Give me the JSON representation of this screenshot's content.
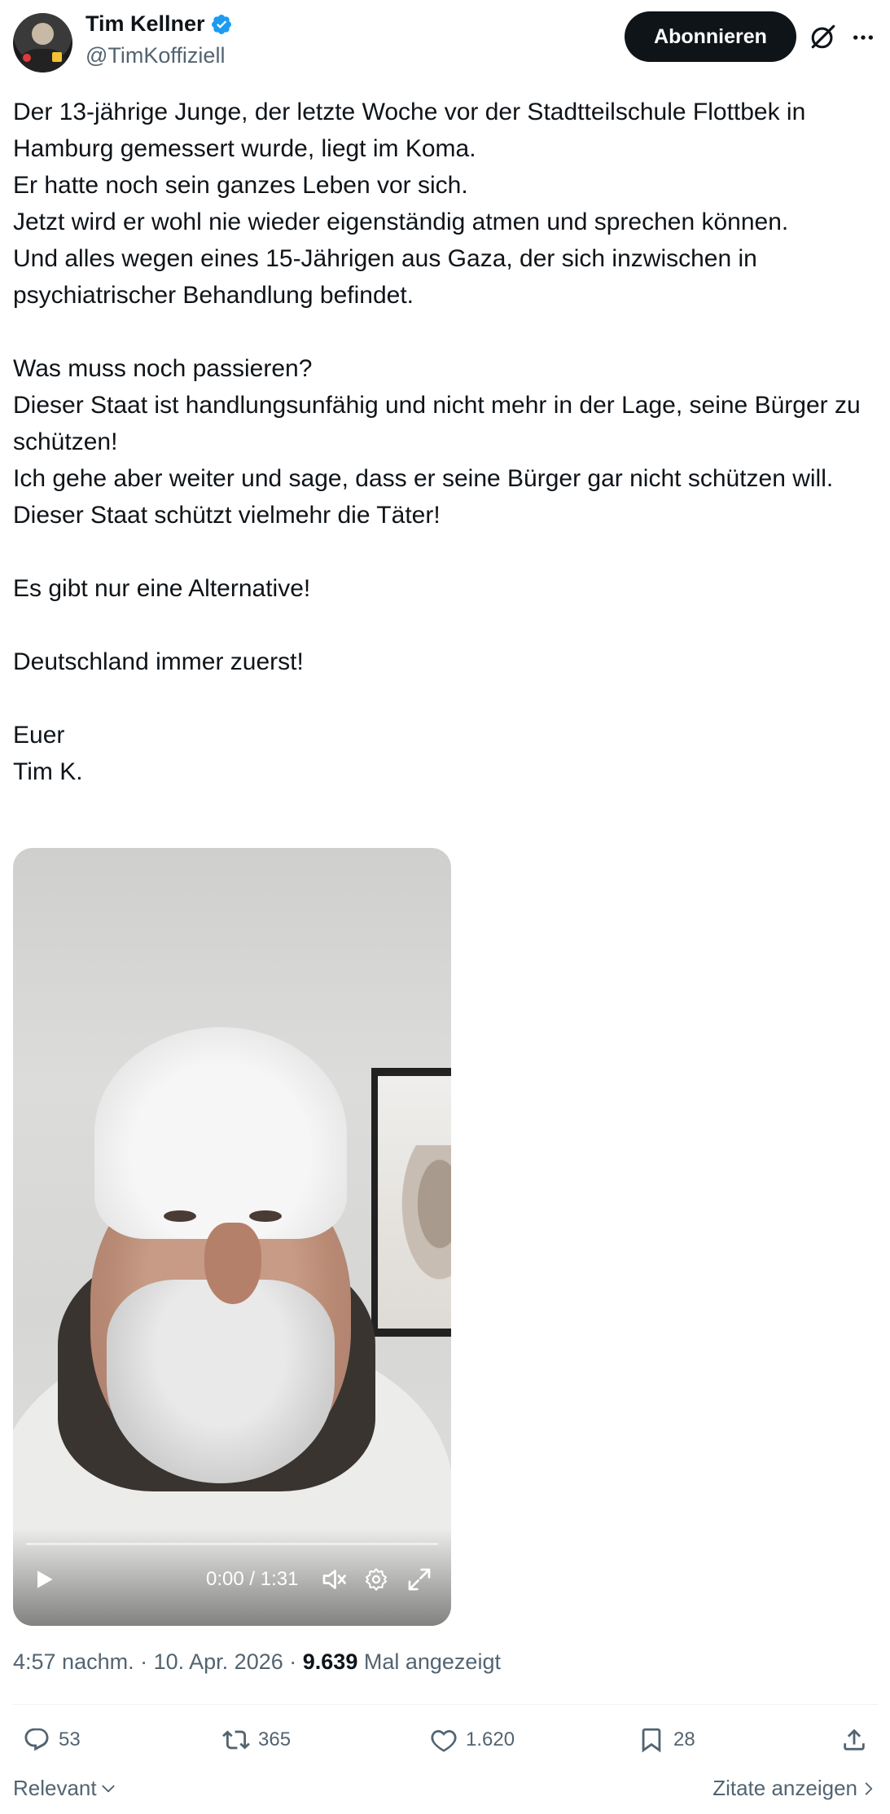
{
  "author": {
    "display_name": "Tim Kellner",
    "handle": "@TimKoffiziell",
    "verified": true,
    "verified_color": "#1d9bf0"
  },
  "header": {
    "subscribe_label": "Abonnieren",
    "grok_icon": "grok-icon",
    "more_icon": "more-icon"
  },
  "tweet": {
    "paragraphs": [
      "Der 13-jährige Junge, der letzte Woche vor der Stadtteilschule Flottbek in Hamburg gemessert wurde, liegt im Koma.\nEr hatte noch sein ganzes Leben vor sich.\nJetzt wird er wohl nie wieder eigenständig atmen und sprechen können.\nUnd alles wegen eines 15-Jährigen aus Gaza, der sich inzwischen in psychiatrischer Behandlung befindet.",
      "Was muss noch passieren?\nDieser Staat ist handlungsunfähig und nicht mehr in der Lage, seine Bürger zu schützen!\nIch gehe aber weiter und sage, dass er seine Bürger gar nicht schützen will.\nDieser Staat schützt vielmehr die Täter!",
      "Es gibt nur eine Alternative!",
      "Deutschland immer zuerst!",
      "Euer\nTim K."
    ]
  },
  "video": {
    "time": "0:00 / 1:31",
    "progress": 0.0
  },
  "meta": {
    "time": "4:57 nachm.",
    "date": "10. Apr. 2026",
    "views": "9.639",
    "views_label": "Mal angezeigt"
  },
  "actions": {
    "replies": "53",
    "reposts": "365",
    "likes": "1.620",
    "bookmarks": "28"
  },
  "footer": {
    "sort_label": "Relevant",
    "quotes_label": "Zitate anzeigen"
  },
  "colors": {
    "text": "#0f1419",
    "secondary": "#536471",
    "button_bg": "#0f1419"
  }
}
